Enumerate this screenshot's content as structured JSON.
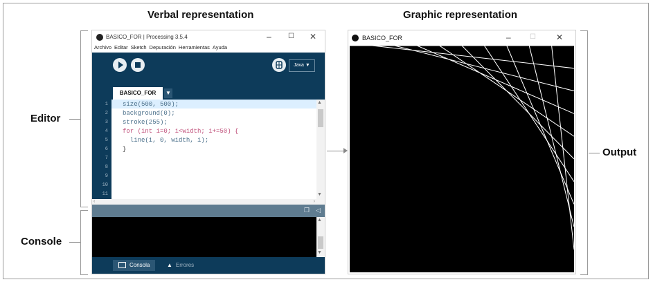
{
  "headings": {
    "verbal": "Verbal representation",
    "graphic": "Graphic representation"
  },
  "labels": {
    "editor": "Editor",
    "console": "Console",
    "output": "Output"
  },
  "ide": {
    "title": "BASICO_FOR | Processing 3.5.4",
    "menu": [
      "Archivo",
      "Editar",
      "Sketch",
      "Depuración",
      "Herramientas",
      "Ayuda"
    ],
    "mode": "Java ▼",
    "tab": "BASICO_FOR",
    "line_numbers": [
      "1",
      "2",
      "3",
      "4",
      "5",
      "6",
      "7",
      "8",
      "9",
      "10",
      "11"
    ],
    "code": [
      "size(500, 500);",
      "background(0);",
      "stroke(255);",
      "for (int i=0; i<width; i+=50) {",
      "  line(i, 0, width, i);",
      "}"
    ],
    "console_tabs": [
      "Consola",
      "Errores"
    ]
  },
  "output": {
    "title": "BASICO_FOR"
  },
  "sketch": {
    "size": 500,
    "step": 50
  },
  "colors": {
    "ide_dark": "#0d3b5a",
    "canvas": "#000000",
    "stroke": "#ffffff"
  }
}
